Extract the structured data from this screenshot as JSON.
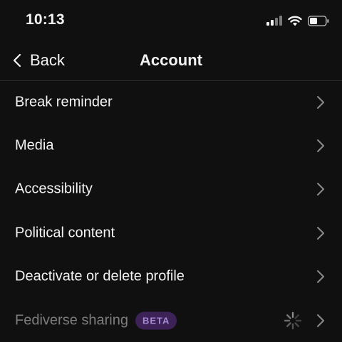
{
  "status_bar": {
    "time": "10:13",
    "icons": [
      "signal-bars-icon",
      "wifi-icon",
      "battery-icon"
    ]
  },
  "nav": {
    "back_label": "Back",
    "title": "Account"
  },
  "items": [
    {
      "label": "Break reminder"
    },
    {
      "label": "Media"
    },
    {
      "label": "Accessibility"
    },
    {
      "label": "Political content"
    },
    {
      "label": "Deactivate or delete profile"
    },
    {
      "label": "Fediverse sharing",
      "badge": "BETA",
      "disabled": true,
      "loading": true
    }
  ],
  "colors": {
    "background": "#101010",
    "text": "#f3f3f3",
    "muted_text": "#7d7d7d",
    "chevron": "#8a8a8a",
    "badge_bg": "#3c2257",
    "badge_text": "#a58bd3"
  }
}
